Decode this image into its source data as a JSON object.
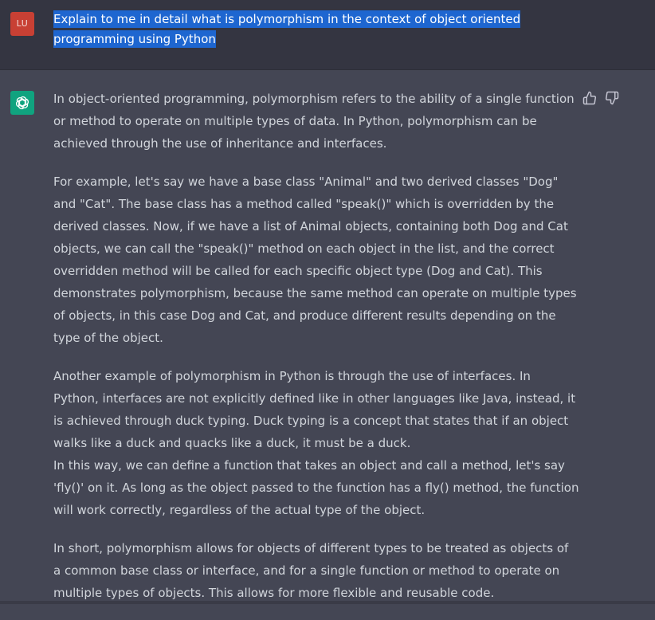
{
  "user": {
    "avatar_initials": "LU",
    "avatar_color": "#c84034",
    "message": "Explain to me in detail what is polymorphism in the context of object oriented programming using Python"
  },
  "assistant": {
    "avatar_icon": "openai-logo-icon",
    "avatar_color": "#10a37f",
    "paragraphs": [
      "In object-oriented programming, polymorphism refers to the ability of a single function or method to operate on multiple types of data. In Python, polymorphism can be achieved through the use of inheritance and interfaces.",
      "For example, let's say we have a base class \"Animal\" and two derived classes \"Dog\" and \"Cat\". The base class has a method called \"speak()\" which is overridden by the derived classes. Now, if we have a list of Animal objects, containing both Dog and Cat objects, we can call the \"speak()\" method on each object in the list, and the correct overridden method will be called for each specific object type (Dog and Cat). This demonstrates polymorphism, because the same method can operate on multiple types of objects, in this case Dog and Cat, and produce different results depending on the type of the object.",
      "Another example of polymorphism in Python is through the use of interfaces. In Python, interfaces are not explicitly defined like in other languages like Java, instead, it is achieved through duck typing. Duck typing is a concept that states that if an object walks like a duck and quacks like a duck, it must be a duck.\nIn this way, we can define a function that takes an object and call a method, let's say 'fly()' on it. As long as the object passed to the function has a fly() method, the function will work correctly, regardless of the actual type of the object.",
      "In short, polymorphism allows for objects of different types to be treated as objects of a common base class or interface, and for a single function or method to operate on multiple types of objects. This allows for more flexible and reusable code."
    ],
    "feedback": {
      "thumbs_up_icon": "thumbs-up-icon",
      "thumbs_down_icon": "thumbs-down-icon"
    }
  },
  "colors": {
    "user_bg": "#343541",
    "assistant_bg": "#444654",
    "selection": "#1e66d0",
    "text": "#d1d5db"
  }
}
